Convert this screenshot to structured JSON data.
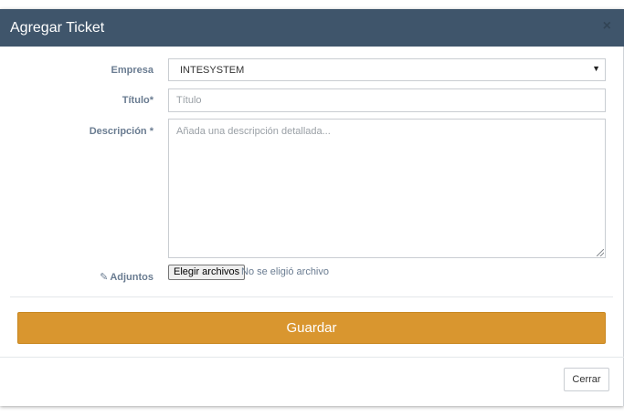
{
  "modal": {
    "title": "Agregar Ticket",
    "close_symbol": "×"
  },
  "form": {
    "empresa": {
      "label": "Empresa",
      "value": "INTESYSTEM",
      "caret": "▼"
    },
    "titulo": {
      "label": "Título*",
      "placeholder": "Título"
    },
    "descripcion": {
      "label": "Descripción *",
      "placeholder": "Añada una descripción detallada..."
    },
    "adjuntos": {
      "label": "Adjuntos",
      "icon": "paperclip-icon",
      "icon_glyph": "✎",
      "button_label": "Elegir archivos",
      "status": "No se eligió archivo"
    },
    "save_label": "Guardar"
  },
  "footer": {
    "close_label": "Cerrar"
  },
  "colors": {
    "header_bg": "#3f556b",
    "save_bg": "#d9962f",
    "label_text": "#6a7c91"
  }
}
